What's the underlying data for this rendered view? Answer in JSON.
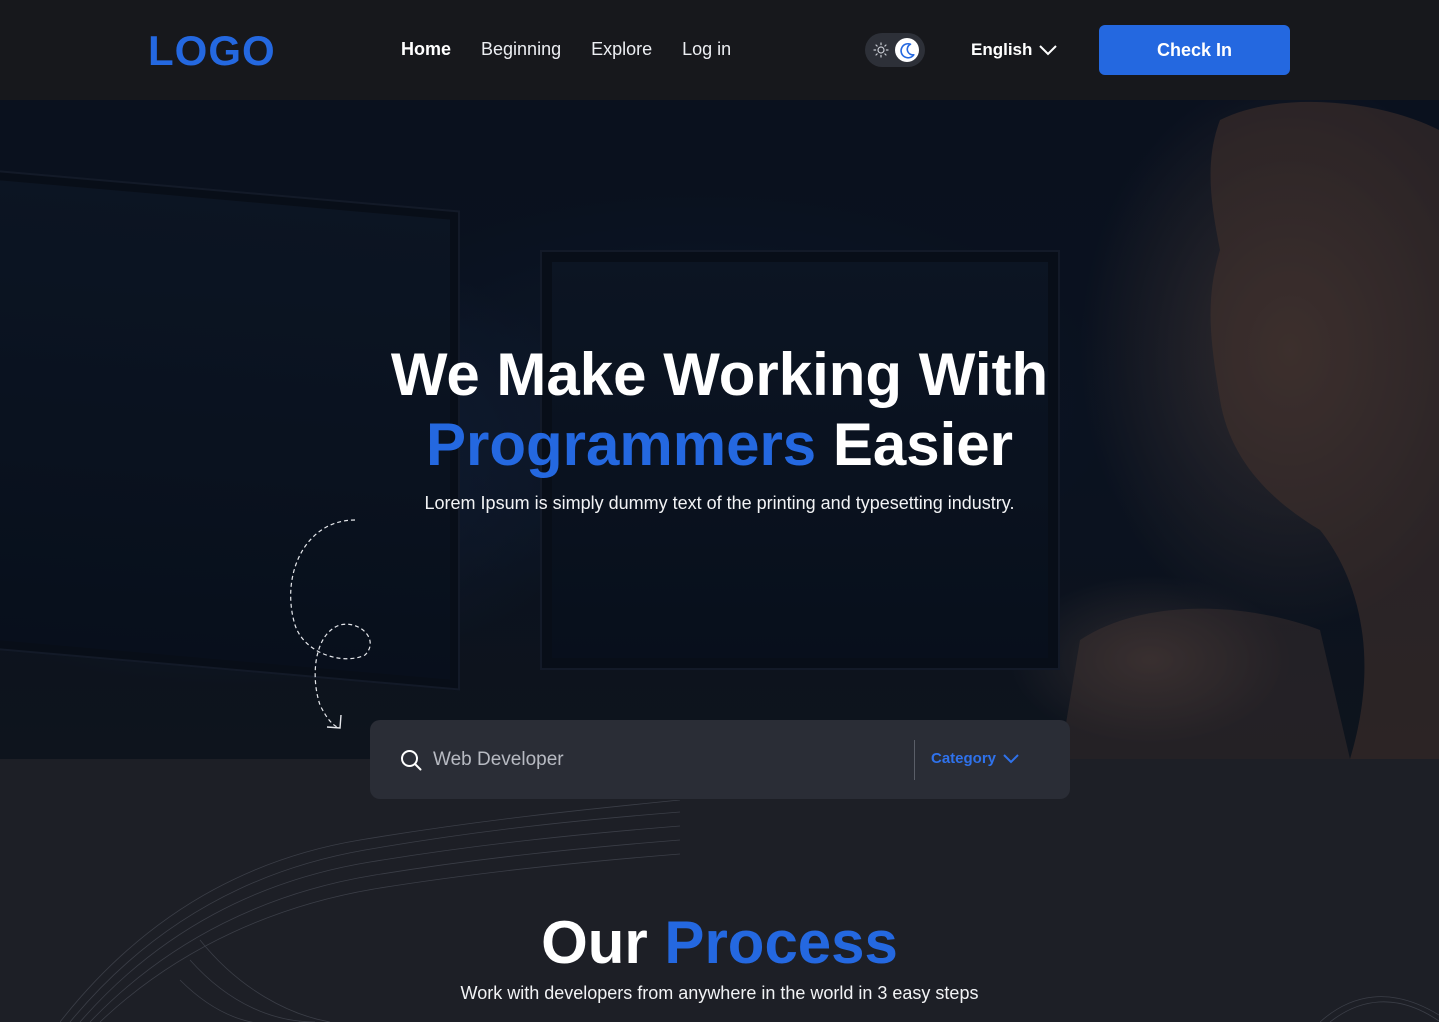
{
  "header": {
    "logo": "LOGO",
    "nav": [
      "Home",
      "Beginning",
      "Explore",
      "Log in"
    ],
    "theme_toggle": {
      "mode": "dark",
      "icons": [
        "sun-icon",
        "moon-icon"
      ]
    },
    "language": "English",
    "cta": "Check In"
  },
  "hero": {
    "title_line1": "We Make Working With",
    "title_accent": "Programmers",
    "title_rest": " Easier",
    "subtitle": "Lorem Ipsum is simply dummy text of the printing and typesetting industry."
  },
  "search": {
    "value": "",
    "placeholder": "Web Developer",
    "category_label": "Category"
  },
  "process": {
    "title_plain": "Our ",
    "title_accent": "Process",
    "subtitle": "Work with developers from anywhere in the world in 3 easy steps"
  },
  "colors": {
    "accent": "#2468e0",
    "header_bg": "#17181c",
    "page_bg": "#1d1f26",
    "search_bg": "#2a2d36"
  }
}
